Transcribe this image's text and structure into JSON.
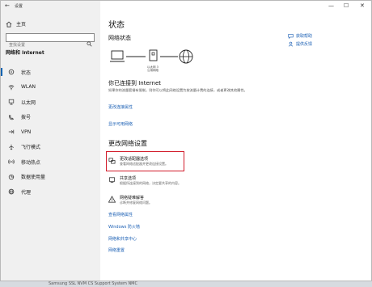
{
  "app": {
    "title": "设置",
    "back_glyph": "←"
  },
  "window_controls": {
    "minimize": "—",
    "maximize": "☐",
    "close": "✕"
  },
  "sidebar": {
    "home_label": "主页",
    "search_placeholder": "查找设置",
    "section_title": "网络和 Internet",
    "items": [
      {
        "label": "状态",
        "icon": "status-icon",
        "active": true
      },
      {
        "label": "WLAN",
        "icon": "wifi-icon"
      },
      {
        "label": "以太网",
        "icon": "ethernet-icon"
      },
      {
        "label": "拨号",
        "icon": "dialup-icon"
      },
      {
        "label": "VPN",
        "icon": "vpn-icon"
      },
      {
        "label": "飞行模式",
        "icon": "airplane-icon"
      },
      {
        "label": "移动热点",
        "icon": "hotspot-icon"
      },
      {
        "label": "数据使用量",
        "icon": "data-usage-icon"
      },
      {
        "label": "代理",
        "icon": "globe-icon"
      }
    ]
  },
  "main": {
    "title": "状态",
    "network_status_heading": "网络状态",
    "diagram_label_1": "以太网 3",
    "diagram_label_2": "公用网络",
    "connected_heading": "你已连接到 Internet",
    "connected_desc": "如果你的流量套餐有限制，则你可以将此网络设置为按流量计费的连接，或者更改其他属性。",
    "change_props_link": "更改连接属性",
    "show_networks_link": "显示可用网络",
    "change_settings_heading": "更改网络设置",
    "options": [
      {
        "title": "更改适配器选项",
        "desc": "查看网络适配器并更改连接设置。",
        "icon": "adapter-icon"
      },
      {
        "title": "共享选项",
        "desc": "根据所连接到的网络，决定要共享的内容。",
        "icon": "sharing-icon"
      },
      {
        "title": "网络疑难解答",
        "desc": "诊断并修复网络问题。",
        "icon": "warning-icon"
      }
    ],
    "links": {
      "hardware_props": "查看网络属性",
      "firewall": "Windows 防火墙",
      "sharing_center": "网络和共享中心",
      "reset": "网络重置"
    }
  },
  "right_panel": {
    "help": "获取帮助",
    "feedback": "提供反馈"
  },
  "taskbar": {
    "text": "Samsung SSL NVM CS Support System NMC"
  }
}
